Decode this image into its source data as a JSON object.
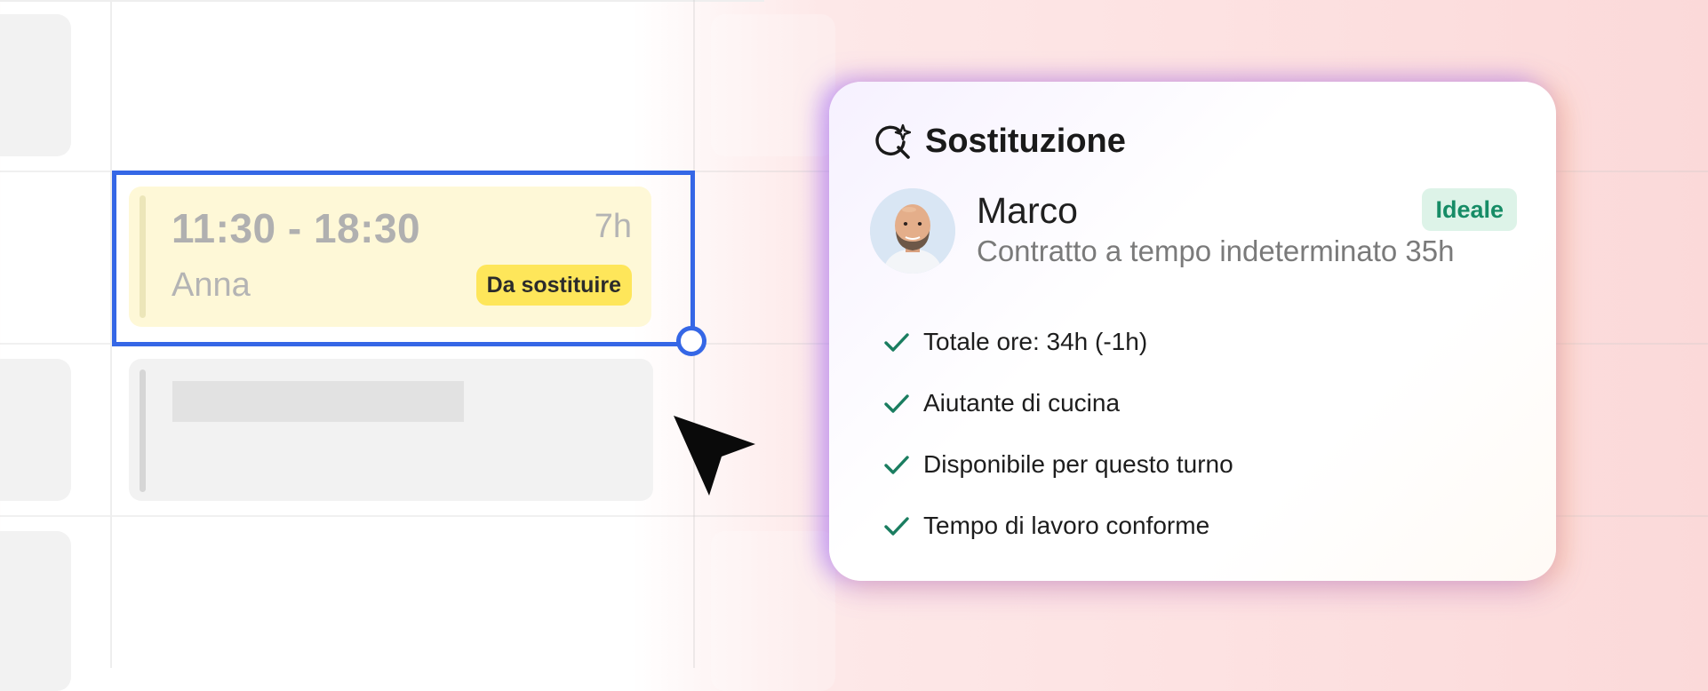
{
  "shift": {
    "time_range": "11:30 - 18:30",
    "duration": "7h",
    "employee": "Anna",
    "status_badge": "Da sostituire",
    "colors": {
      "card": "#fef8d7",
      "badge": "#fee65a",
      "selection": "#3567e6"
    }
  },
  "replacement_card": {
    "icon": "magic-search-icon",
    "title": "Sostituzione",
    "candidate": {
      "name": "Marco",
      "contract": "Contratto a tempo indeterminato 35h",
      "badge": "Ideale"
    },
    "checks": [
      {
        "icon": "check-icon",
        "label": "Totale ore: 34h (-1h)"
      },
      {
        "icon": "check-icon",
        "label": "Aiutante di cucina"
      },
      {
        "icon": "check-icon",
        "label": "Disponibile per questo turno"
      },
      {
        "icon": "check-icon",
        "label": "Tempo di lavoro conforme"
      }
    ],
    "colors": {
      "badge_bg": "#ddf3e8",
      "badge_text": "#168c66",
      "check": "#1a7d60"
    }
  }
}
